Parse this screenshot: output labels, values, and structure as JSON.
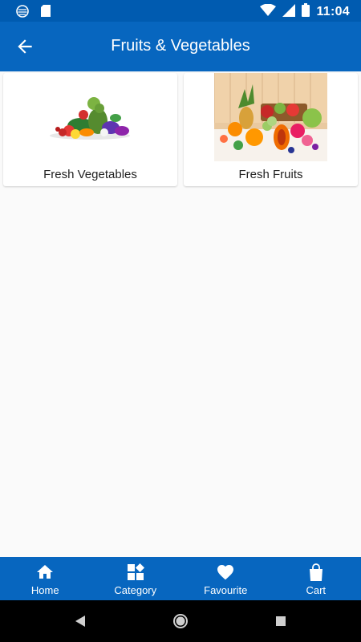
{
  "status_bar": {
    "time": "11:04",
    "icons": [
      "app-notification-icon",
      "sd-card-icon",
      "wifi-icon",
      "cell-signal-icon",
      "battery-icon"
    ]
  },
  "app_bar": {
    "title": "Fruits & Vegetables",
    "back_icon": "arrow-left-icon"
  },
  "categories": [
    {
      "label": "Fresh Vegetables",
      "image": "vegetables-image"
    },
    {
      "label": "Fresh Fruits",
      "image": "fruits-image"
    }
  ],
  "bottom_nav": {
    "items": [
      {
        "label": "Home",
        "icon": "home-icon"
      },
      {
        "label": "Category",
        "icon": "category-icon"
      },
      {
        "label": "Favourite",
        "icon": "heart-icon"
      },
      {
        "label": "Cart",
        "icon": "shopping-bag-icon"
      }
    ]
  },
  "system_nav": {
    "buttons": [
      "back-triangle-icon",
      "home-circle-icon",
      "recents-square-icon"
    ]
  },
  "colors": {
    "primary": "#0766bf",
    "status_bar": "#005bb0",
    "background": "#fafafa"
  }
}
